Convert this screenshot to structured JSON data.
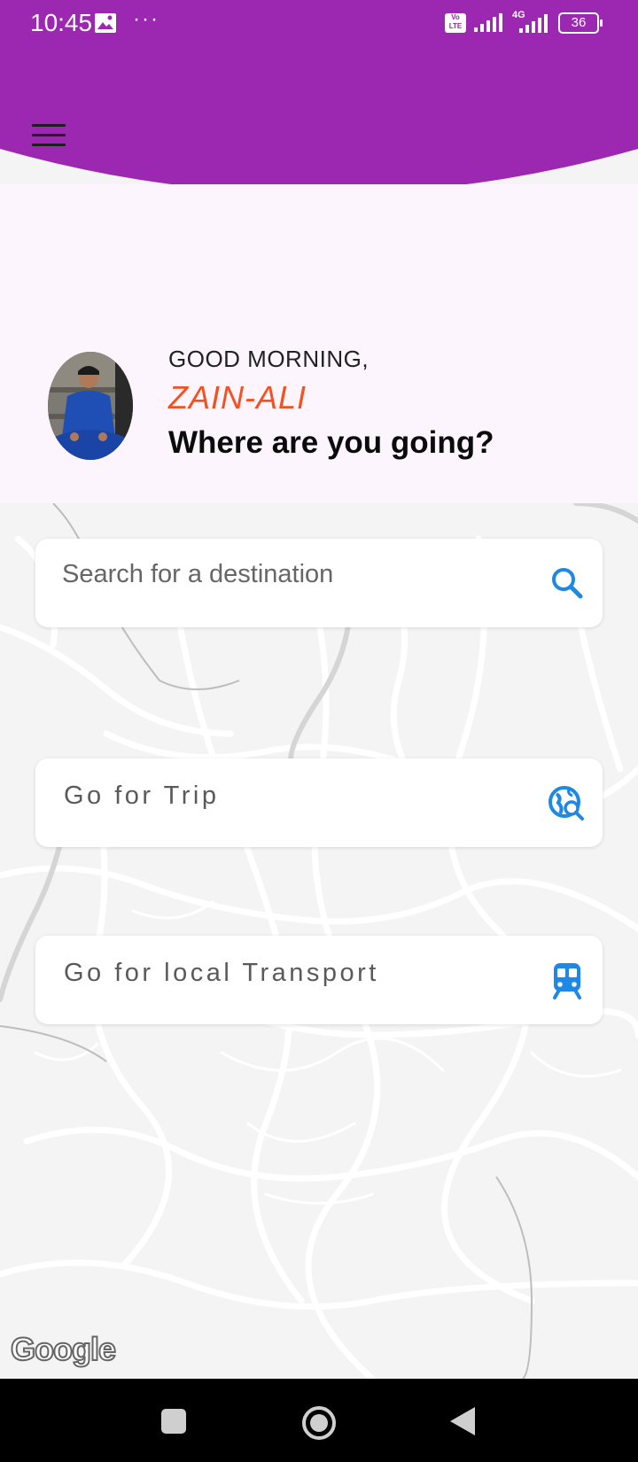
{
  "status_bar": {
    "time": "10:45",
    "more": "···",
    "volte": "Vo LTE",
    "network_type": "4G",
    "battery": "36"
  },
  "colors": {
    "header": "#9c27b0",
    "name": "#f4511e",
    "icon": "#1e88e5"
  },
  "header": {
    "menu_icon": "hamburger-menu-icon"
  },
  "greeting": {
    "salutation": "GOOD MORNING,",
    "name": "ZAIN-ALI",
    "question": "Where are you going?"
  },
  "search": {
    "placeholder": "Search for a destination",
    "icon": "search-icon"
  },
  "actions": [
    {
      "label": "Go for Trip",
      "icon": "travel-explore-icon"
    },
    {
      "label": "Go for local Transport",
      "icon": "train-icon"
    }
  ],
  "map": {
    "attribution": "Google"
  },
  "nav": {
    "icons": [
      "recents-square-icon",
      "home-circle-icon",
      "back-triangle-icon"
    ]
  }
}
